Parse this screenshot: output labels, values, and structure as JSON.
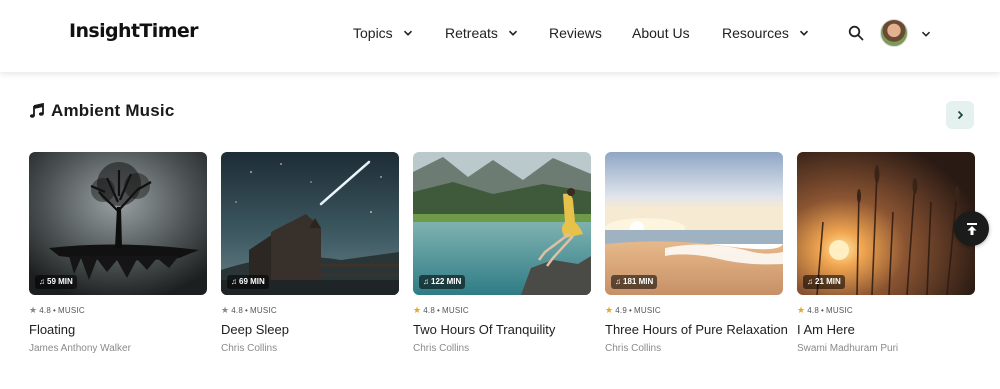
{
  "header": {
    "logo": "InsightTimer",
    "nav": [
      {
        "label": "Topics",
        "has_dropdown": true
      },
      {
        "label": "Retreats",
        "has_dropdown": true
      },
      {
        "label": "Reviews",
        "has_dropdown": false
      },
      {
        "label": "About Us",
        "has_dropdown": false
      },
      {
        "label": "Resources",
        "has_dropdown": true
      }
    ],
    "search_icon": "search-icon",
    "avatar_icon": "user-avatar"
  },
  "section": {
    "title": "Ambient Music",
    "icon": "music-note-icon",
    "next_icon": "chevron-right-icon"
  },
  "cards": [
    {
      "duration": "59 MIN",
      "rating": "4.8",
      "category": "MUSIC",
      "title": "Floating",
      "author": "James Anthony Walker",
      "star_color": "#8a8a8a"
    },
    {
      "duration": "69 MIN",
      "rating": "4.8",
      "category": "MUSIC",
      "title": "Deep Sleep",
      "author": "Chris Collins",
      "star_color": "#8a8a8a"
    },
    {
      "duration": "122 MIN",
      "rating": "4.8",
      "category": "MUSIC",
      "title": "Two Hours Of Tranquility",
      "author": "Chris Collins",
      "star_color": "#e2a92b"
    },
    {
      "duration": "181 MIN",
      "rating": "4.9",
      "category": "MUSIC",
      "title": "Three Hours of Pure Relaxation",
      "author": "Chris Collins",
      "star_color": "#e2a92b"
    },
    {
      "duration": "21 MIN",
      "rating": "4.8",
      "category": "MUSIC",
      "title": "I Am Here",
      "author": "Swami Madhuram Puri",
      "star_color": "#e2a92b"
    }
  ],
  "scroll_top_icon": "scroll-to-top-icon"
}
